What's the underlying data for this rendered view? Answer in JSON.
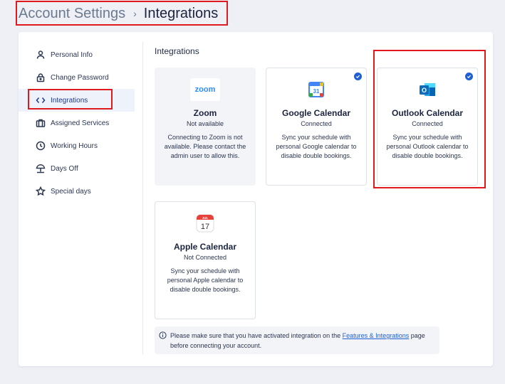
{
  "breadcrumb": {
    "parent": "Account Settings",
    "separator": "›",
    "current": "Integrations"
  },
  "sidebar": {
    "items": [
      {
        "label": "Personal Info",
        "icon": "user-icon"
      },
      {
        "label": "Change Password",
        "icon": "lock-icon"
      },
      {
        "label": "Integrations",
        "icon": "code-icon",
        "active": true
      },
      {
        "label": "Assigned Services",
        "icon": "briefcase-icon"
      },
      {
        "label": "Working Hours",
        "icon": "clock-icon"
      },
      {
        "label": "Days Off",
        "icon": "beach-umbrella-icon"
      },
      {
        "label": "Special days",
        "icon": "star-icon"
      }
    ]
  },
  "main": {
    "title": "Integrations",
    "cards": [
      {
        "name": "Zoom",
        "logo_text": "zoom",
        "status": "Not available",
        "description": "Connecting to Zoom is not available. Please contact the admin user to allow this.",
        "connected": false
      },
      {
        "name": "Google Calendar",
        "logo_text": "31",
        "status": "Connected",
        "description": "Sync your schedule with personal Google calendar to disable double bookings.",
        "connected": true
      },
      {
        "name": "Outlook Calendar",
        "logo_text": "O",
        "status": "Connected",
        "description": "Sync your schedule with personal Outlook calendar to disable double bookings.",
        "connected": true
      },
      {
        "name": "Apple Calendar",
        "logo_month": "JUL",
        "logo_day": "17",
        "status": "Not Connected",
        "description": "Sync your schedule with personal Apple calendar to disable double bookings.",
        "connected": false
      }
    ],
    "note": {
      "text_before": "Please make sure that you have activated integration on the ",
      "link": "Features & Integrations",
      "text_after": " page before connecting your account."
    }
  },
  "colors": {
    "accent": "#1f5fd6",
    "annotation": "#e0191f",
    "zoom_blue": "#2d8cff",
    "outlook_blue": "#0f6cbd"
  }
}
